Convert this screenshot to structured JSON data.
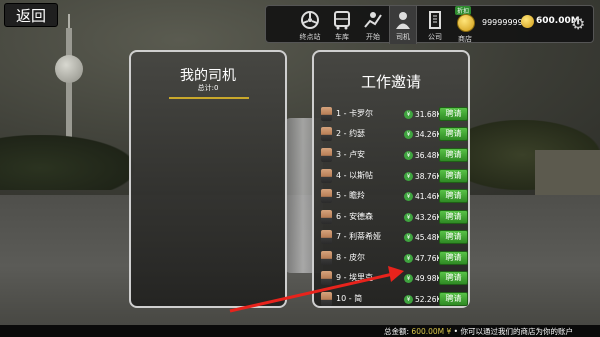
{
  "back_button": "返回",
  "nav": {
    "items": [
      {
        "label": "终点站",
        "icon": "steering-wheel-icon"
      },
      {
        "label": "车库",
        "icon": "bus-icon"
      },
      {
        "label": "开始",
        "icon": "map-route-icon"
      },
      {
        "label": "司机",
        "icon": "driver-person-icon"
      },
      {
        "label": "公司",
        "icon": "building-icon"
      },
      {
        "label": "商店",
        "icon": "coin-stack-icon"
      }
    ],
    "shop_badge": "折扣",
    "coins_balance": "99999999",
    "money_balance": "600.00M"
  },
  "my_drivers": {
    "title": "我的司机",
    "total": "总计:0"
  },
  "job_invites": {
    "title": "工作邀请",
    "hire_label": "聘请",
    "drivers": [
      {
        "name": "1 - 卡罗尔",
        "salary": "31.68K"
      },
      {
        "name": "2 - 约瑟",
        "salary": "34.26K"
      },
      {
        "name": "3 - 卢安",
        "salary": "36.48K"
      },
      {
        "name": "4 - 以斯帖",
        "salary": "38.76K"
      },
      {
        "name": "5 - 瞻羚",
        "salary": "41.46K"
      },
      {
        "name": "6 - 安德森",
        "salary": "43.26K"
      },
      {
        "name": "7 - 利蒂希娅",
        "salary": "45.48K"
      },
      {
        "name": "8 - 皮尔",
        "salary": "47.76K"
      },
      {
        "name": "9 - 埃里克",
        "salary": "49.98K"
      },
      {
        "name": "10 - 简",
        "salary": "52.26K"
      }
    ]
  },
  "bottom": {
    "prefix": "总金额: ",
    "amount": "600.00M ¥",
    "suffix": " • 你可以通过我们的商店为你的账户"
  },
  "colors": {
    "hire_green": "#3fa43f",
    "accent_gold": "#c9a82b",
    "arrow_red": "#e8231c"
  }
}
